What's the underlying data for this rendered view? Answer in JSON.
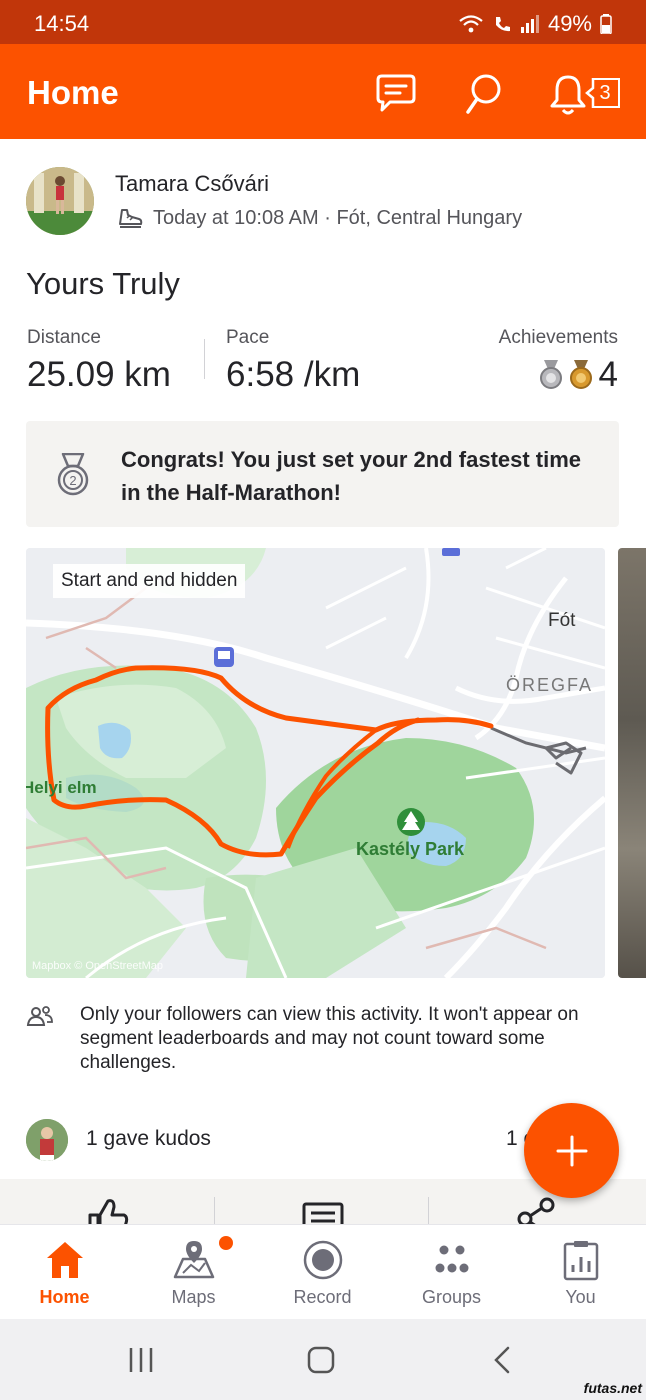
{
  "status_bar": {
    "time": "14:54",
    "battery": "49%"
  },
  "app_bar": {
    "title": "Home",
    "notification_count": "3"
  },
  "activity": {
    "athlete_name": "Tamara Csővári",
    "meta": "Today at 10:08 AM · Fót, Central Hungary",
    "title": "Yours Truly",
    "stats": {
      "distance_label": "Distance",
      "distance_value": "25.09 km",
      "pace_label": "Pace",
      "pace_value": "6:58 /km",
      "achievements_label": "Achievements",
      "achievements_value": "4"
    },
    "congrats": "Congrats! You just set your 2nd fastest time in the Half-Marathon!",
    "map": {
      "chip": "Start and end hidden",
      "place_fot": "Fót",
      "place_oregfa": "ÖREGFA",
      "place_park": "Kastély Park",
      "place_left": "Helyi elm",
      "attribution": "Mapbox © OpenStreetMap"
    },
    "privacy_text": "Only your followers can view this activity. It won't appear on segment leaderboards and may not count toward some challenges.",
    "kudos_text": "1 gave kudos",
    "comments_text": "1 c"
  },
  "bottom_nav": [
    {
      "label": "Home",
      "icon": "home-icon"
    },
    {
      "label": "Maps",
      "icon": "maps-icon"
    },
    {
      "label": "Record",
      "icon": "record-icon"
    },
    {
      "label": "Groups",
      "icon": "groups-icon"
    },
    {
      "label": "You",
      "icon": "you-icon"
    }
  ],
  "watermark": "futas.net",
  "colors": {
    "brand": "#fc5200",
    "status_bar": "#c1360a",
    "route": "#fc5200"
  }
}
